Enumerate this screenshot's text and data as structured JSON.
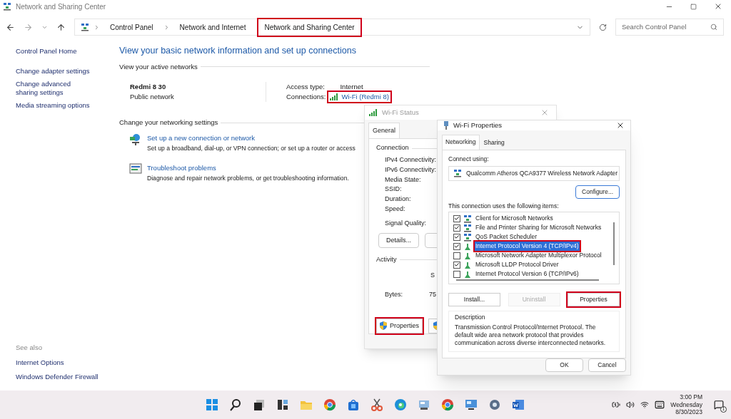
{
  "window": {
    "title": "Network and Sharing Center"
  },
  "breadcrumbs": [
    {
      "label": "Control Panel",
      "highlighted": false
    },
    {
      "label": "Network and Internet",
      "highlighted": false
    },
    {
      "label": "Network and Sharing Center",
      "highlighted": true
    }
  ],
  "search": {
    "placeholder": "Search Control Panel"
  },
  "sidebar": {
    "items": [
      "Control Panel Home",
      "Change adapter settings",
      "Change advanced sharing settings",
      "Media streaming options"
    ],
    "see_also_title": "See also",
    "see_also": [
      "Internet Options",
      "Windows Defender Firewall"
    ]
  },
  "heading": "View your basic network information and set up connections",
  "active_networks": {
    "title": "View your active networks",
    "name": "Redmi 8 30",
    "category": "Public network",
    "access_label": "Access type:",
    "access_value": "Internet",
    "connections_label": "Connections:",
    "connection": {
      "label": "Wi-Fi (Redmi 8)",
      "highlighted": true
    }
  },
  "settings": {
    "title": "Change your networking settings",
    "items": [
      {
        "kind": "setup",
        "link": "Set up a new connection or network",
        "description": "Set up a broadband, dial-up, or VPN connection; or set up a router or access"
      },
      {
        "kind": "troubleshoot",
        "link": "Troubleshoot problems",
        "description": "Diagnose and repair network problems, or get troubleshooting information."
      }
    ]
  },
  "wifi_status": {
    "title": "Wi-Fi Status",
    "tab": "General",
    "connection_title": "Connection",
    "fields": [
      "IPv4 Connectivity:",
      "IPv6 Connectivity:",
      "Media State:",
      "SSID:",
      "Duration:",
      "Speed:"
    ],
    "signal_label": "Signal Quality:",
    "details_button": "Details...",
    "activity_title": "Activity",
    "sent_label": "S",
    "bytes_label": "Bytes:",
    "bytes_value": "75",
    "properties_button": {
      "label": "Properties",
      "highlighted": true
    }
  },
  "wifi_properties": {
    "title": "Wi-Fi Properties",
    "tabs": [
      {
        "label": "Networking",
        "selected": true
      },
      {
        "label": "Sharing",
        "selected": false
      }
    ],
    "connect_using_label": "Connect using:",
    "adapter": "Qualcomm Atheros QCA9377 Wireless Network Adapter",
    "configure_button": "Configure...",
    "items_label": "This connection uses the following items:",
    "items": [
      {
        "kind": "client",
        "label": "Client for Microsoft Networks",
        "checked": true,
        "selected": false,
        "highlighted": false
      },
      {
        "kind": "client",
        "label": "File and Printer Sharing for Microsoft Networks",
        "checked": true,
        "selected": false,
        "highlighted": false
      },
      {
        "kind": "client",
        "label": "QoS Packet Scheduler",
        "checked": true,
        "selected": false,
        "highlighted": false
      },
      {
        "kind": "protocol",
        "label": "Internet Protocol Version 4 (TCP/IPv4)",
        "checked": true,
        "selected": true,
        "highlighted": true
      },
      {
        "kind": "protocol",
        "label": "Microsoft Network Adapter Multiplexor Protocol",
        "checked": false,
        "selected": false,
        "highlighted": false
      },
      {
        "kind": "protocol",
        "label": "Microsoft LLDP Protocol Driver",
        "checked": true,
        "selected": false,
        "highlighted": false
      },
      {
        "kind": "protocol",
        "label": "Internet Protocol Version 6 (TCP/IPv6)",
        "checked": false,
        "selected": false,
        "highlighted": false
      }
    ],
    "buttons": [
      {
        "label": "Install...",
        "disabled": false,
        "highlighted": false
      },
      {
        "label": "Uninstall",
        "disabled": true,
        "highlighted": false
      },
      {
        "label": "Properties",
        "disabled": false,
        "highlighted": true
      }
    ],
    "description_title": "Description",
    "description": "Transmission Control Protocol/Internet Protocol. The default wide area network protocol that provides communication across diverse interconnected networks.",
    "footer_buttons": [
      "OK",
      "Cancel"
    ]
  },
  "taskbar": {
    "time": "3:00 PM",
    "day": "Wednesday",
    "date": "8/30/2023",
    "notifications": "1"
  }
}
